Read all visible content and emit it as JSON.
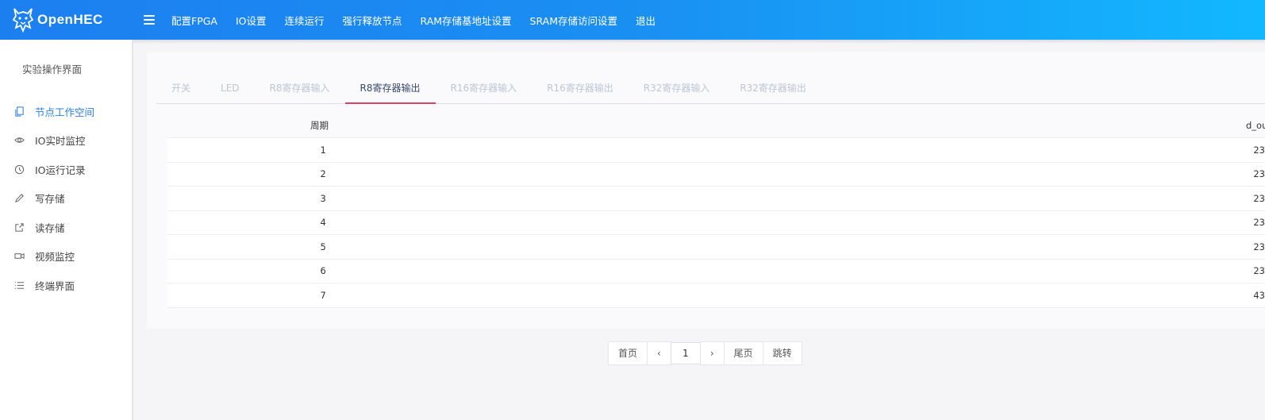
{
  "brand": {
    "name": "OpenHEC"
  },
  "nav": [
    "配置FPGA",
    "IO设置",
    "连续运行",
    "强行释放节点",
    "RAM存储基地址设置",
    "SRAM存储访问设置",
    "退出"
  ],
  "sidebar": {
    "title": "实验操作界面",
    "items": [
      {
        "label": "节点工作空间",
        "icon": "document-copy-icon",
        "active": true
      },
      {
        "label": "IO实时监控",
        "icon": "eye-icon"
      },
      {
        "label": "IO运行记录",
        "icon": "clock-icon"
      },
      {
        "label": "写存储",
        "icon": "pencil-icon"
      },
      {
        "label": "读存储",
        "icon": "export-icon"
      },
      {
        "label": "视频监控",
        "icon": "video-camera-icon"
      },
      {
        "label": "终端界面",
        "icon": "list-icon"
      }
    ]
  },
  "tabs": [
    "开关",
    "LED",
    "R8寄存器输入",
    "R8寄存器输出",
    "R16寄存器输入",
    "R16寄存器输出",
    "R32寄存器输入",
    "R32寄存器输出"
  ],
  "active_tab": "R8寄存器输出",
  "table": {
    "headers": [
      "周期",
      "d_out"
    ],
    "rows": [
      [
        "1",
        "23"
      ],
      [
        "2",
        "23"
      ],
      [
        "3",
        "23"
      ],
      [
        "4",
        "23"
      ],
      [
        "5",
        "23"
      ],
      [
        "6",
        "23"
      ],
      [
        "7",
        "43"
      ]
    ]
  },
  "pager": {
    "first": "首页",
    "prev": "‹",
    "page": "1",
    "next": "›",
    "last": "尾页",
    "jump": "跳转"
  },
  "colors": {
    "header_start": "#1c7ff0",
    "header_end": "#12b8ff",
    "active": "#2a7ee6",
    "tab_underline": "#d9406a"
  }
}
